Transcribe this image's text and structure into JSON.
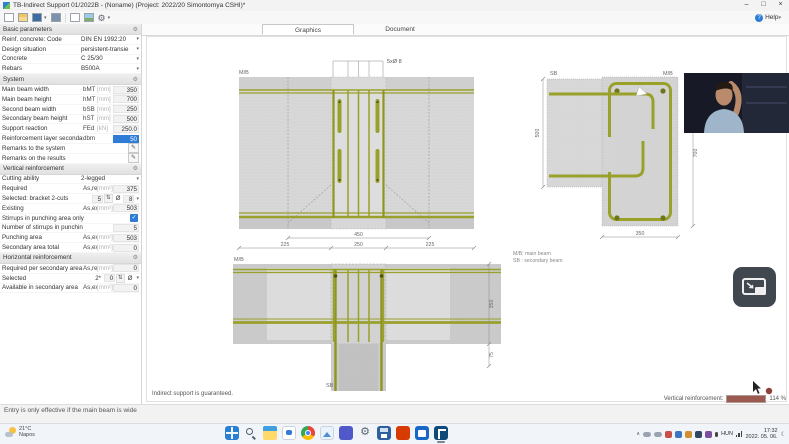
{
  "window": {
    "title": "TB-Indirect Support 01/2022B - (Noname) (Project: 2022/20 Simontornya CSHI)*"
  },
  "icons": {
    "dropdown": "▾",
    "spinner": "⇅",
    "gear": "⚙",
    "edit": "✎",
    "check": "✓",
    "help": "?",
    "minimize": "–",
    "maximize": "□",
    "close": "×",
    "tray_expand": "∧",
    "moon": "☾"
  },
  "toolbar": {
    "help_label": "Help"
  },
  "tabs": [
    {
      "label": "Graphics",
      "active": true
    },
    {
      "label": "Document",
      "active": false
    }
  ],
  "sidebar": {
    "sections": [
      {
        "title": "Basic parameters",
        "rows": [
          {
            "label": "Reinf. concrete: Code",
            "type": "select",
            "value": "DIN EN 1992:20"
          },
          {
            "label": "Design situation",
            "type": "select",
            "value": "persistent-transie"
          },
          {
            "label": "Concrete",
            "type": "select",
            "value": "C 25/30"
          },
          {
            "label": "Rebars",
            "type": "select",
            "value": "B500A"
          }
        ]
      },
      {
        "title": "System",
        "rows": [
          {
            "label": "Main beam width",
            "symbol": "bMT",
            "unit": "[mm]",
            "type": "num",
            "value": "350"
          },
          {
            "label": "Main beam height",
            "symbol": "hMT",
            "unit": "[mm]",
            "type": "num",
            "value": "700"
          },
          {
            "label": "Second beam width",
            "symbol": "bSB",
            "unit": "[mm]",
            "type": "num",
            "value": "250"
          },
          {
            "label": "Secondary beam height",
            "symbol": "hST",
            "unit": "[mm]",
            "type": "num",
            "value": "500"
          },
          {
            "label": "Support reaction",
            "symbol": "FEd",
            "unit": "[kN]",
            "type": "num",
            "value": "250.0"
          },
          {
            "label": "Reinforcement layer secondary beam",
            "symbol": "dbm",
            "unit": "",
            "type": "num-sel",
            "value": "50"
          },
          {
            "label": "Remarks to the system",
            "type": "edit"
          },
          {
            "label": "Remarks on the results",
            "type": "edit"
          }
        ]
      },
      {
        "title": "Vertical reinforcement",
        "rows": [
          {
            "label": "Cutting ability",
            "type": "select",
            "value": "2-legged"
          },
          {
            "label": "Required",
            "symbol": "As,req",
            "unit": "[mm²]",
            "type": "num",
            "value": "375"
          },
          {
            "label": "Selected: bracket 2-cuts",
            "type": "spin-v",
            "count": "5",
            "dia_symbol": "Ø",
            "dia": "8"
          },
          {
            "label": "Existing",
            "symbol": "As,exist",
            "unit": "[mm²]",
            "type": "num",
            "value": "503"
          },
          {
            "label": "Stirrups in punching area only",
            "type": "check",
            "checked": true
          },
          {
            "label": "Number of stirrups in punching area",
            "symbol": "",
            "unit": "",
            "type": "num",
            "value": "5"
          },
          {
            "label": "Punching area",
            "symbol": "As,exist",
            "unit": "[mm²]",
            "type": "num",
            "value": "503"
          },
          {
            "label": "Secondary area total",
            "symbol": "As,exist",
            "unit": "[mm²]",
            "type": "num",
            "value": "0"
          }
        ]
      },
      {
        "title": "Horizontal reinforcement",
        "rows": [
          {
            "label": "Required per secondary area",
            "symbol": "As,req",
            "unit": "[mm²]",
            "type": "num",
            "value": "0"
          },
          {
            "label": "Selected",
            "type": "spin-h",
            "prefix": "2*",
            "count": "0",
            "dia_symbol": "Ø"
          },
          {
            "label": "Available in secondary area",
            "symbol": "As,exist",
            "unit": "[mm²]",
            "type": "num",
            "value": "0"
          }
        ]
      }
    ]
  },
  "graphics": {
    "labels": {
      "mb": "M/B",
      "sb": "SB"
    },
    "annotation_stirrups": "5xØ 8",
    "dims": {
      "elevation_total": "450",
      "elevation_segments": [
        "225",
        "250",
        "225"
      ],
      "section_height": "700",
      "section_width": "350",
      "sb_height": "500",
      "plan_width": "350",
      "plan_offset": "75"
    },
    "legend": {
      "line1": "M/B: main beam",
      "line2": "SB : secondary beam"
    },
    "note": "Indirect support is guaranteed.",
    "utilization": {
      "label": "Vertical reinforcement:",
      "value": "114 %",
      "percent": 114
    }
  },
  "statusbar": {
    "message": "Entry is only effective if the main beam is wide"
  },
  "taskbar": {
    "weather": {
      "temperature": "21°C",
      "condition": "Napos"
    },
    "apps": [
      "start",
      "search",
      "explorer",
      "chat",
      "chrome",
      "photos",
      "teams",
      "settings",
      "save",
      "office",
      "store",
      "frilo"
    ],
    "tray": {
      "language": "HUN",
      "time": "17:32",
      "date": "2022. 05. 06."
    }
  }
}
